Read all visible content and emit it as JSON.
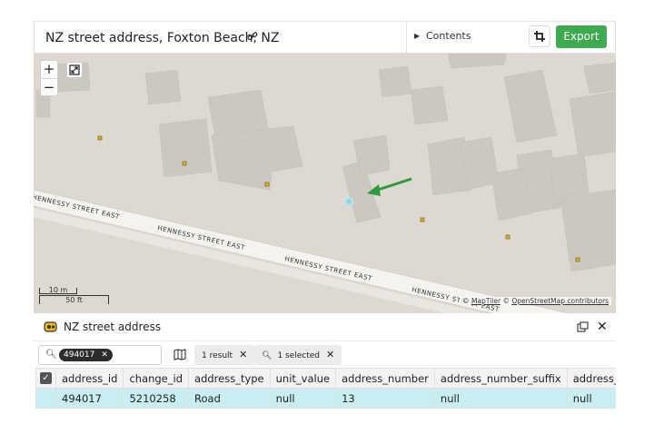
{
  "header": {
    "title": "NZ street address, Foxton Beach, NZ",
    "contents_label": "Contents",
    "export_label": "Export"
  },
  "map": {
    "zoom_in": "+",
    "zoom_out": "−",
    "road_labels": [
      "HENNESSY STREET EAST",
      "HENNESSY STREET EAST",
      "HENNESSY STREET EAST",
      "HENNESSY STREET EAST"
    ],
    "scale_metric": "10 m",
    "scale_imperial": "50 ft",
    "attribution_map": "MapTiler",
    "attribution_osm": "OpenStreetMap contributors",
    "attribution_prefix": "©",
    "colors": {
      "land": "#ddd9d1",
      "building": "#ccc8c0",
      "road": "#f4f3f0",
      "arrow": "#2e9a3c",
      "selected_point": "#8ed8e8",
      "address_point": "#e3b21f"
    }
  },
  "panel": {
    "title": "NZ street address",
    "search_value": "494017",
    "results_chip": "1 result",
    "selected_chip": "1 selected",
    "columns": [
      "address_id",
      "change_id",
      "address_type",
      "unit_value",
      "address_number",
      "address_number_suffix",
      "address_nur"
    ],
    "rows": [
      [
        "494017",
        "5210258",
        "Road",
        "null",
        "13",
        "null",
        "null"
      ]
    ]
  }
}
